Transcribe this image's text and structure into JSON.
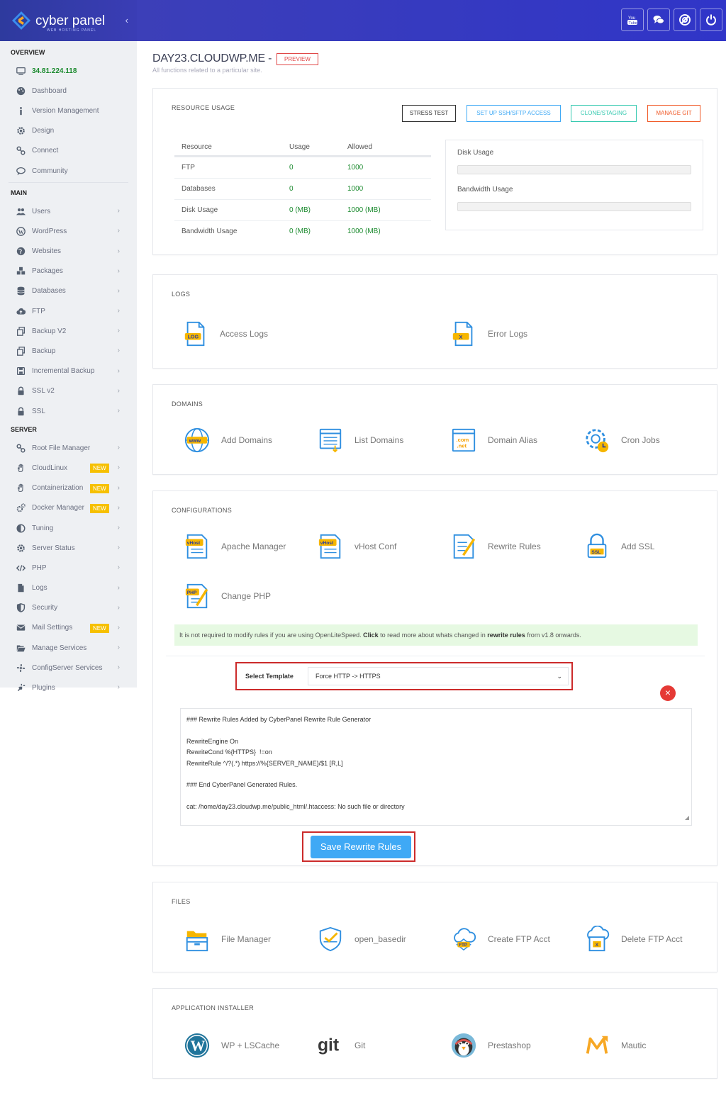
{
  "brand": {
    "name": "cyber panel",
    "tagline": "WEB HOSTING PANEL"
  },
  "sidebar": {
    "overview_label": "OVERVIEW",
    "ip": "34.81.224.118",
    "overview_items": [
      {
        "label": "Dashboard",
        "icon": "palette-icon"
      },
      {
        "label": "Version Management",
        "icon": "info-icon"
      },
      {
        "label": "Design",
        "icon": "gear-icon"
      },
      {
        "label": "Connect",
        "icon": "link-icon"
      },
      {
        "label": "Community",
        "icon": "chat-icon"
      }
    ],
    "main_label": "MAIN",
    "main_items": [
      {
        "label": "Users",
        "icon": "users-icon"
      },
      {
        "label": "WordPress",
        "icon": "wordpress-icon"
      },
      {
        "label": "Websites",
        "icon": "globe-icon"
      },
      {
        "label": "Packages",
        "icon": "cubes-icon"
      },
      {
        "label": "Databases",
        "icon": "database-icon"
      },
      {
        "label": "FTP",
        "icon": "cloud-upload-icon"
      },
      {
        "label": "Backup V2",
        "icon": "copy-icon"
      },
      {
        "label": "Backup",
        "icon": "copy-icon"
      },
      {
        "label": "Incremental Backup",
        "icon": "save-icon"
      },
      {
        "label": "SSL v2",
        "icon": "lock-icon"
      },
      {
        "label": "SSL",
        "icon": "lock-icon"
      }
    ],
    "server_label": "SERVER",
    "server_items": [
      {
        "label": "Root File Manager",
        "icon": "link-icon",
        "badge": ""
      },
      {
        "label": "CloudLinux",
        "icon": "hand-icon",
        "badge": "NEW"
      },
      {
        "label": "Containerization",
        "icon": "hand-icon",
        "badge": "NEW"
      },
      {
        "label": "Docker Manager",
        "icon": "cogs-icon",
        "badge": "NEW"
      },
      {
        "label": "Tuning",
        "icon": "half-circle-icon",
        "badge": ""
      },
      {
        "label": "Server Status",
        "icon": "gear-icon",
        "badge": ""
      },
      {
        "label": "PHP",
        "icon": "code-icon",
        "badge": ""
      },
      {
        "label": "Logs",
        "icon": "file-icon",
        "badge": ""
      },
      {
        "label": "Security",
        "icon": "shield-icon",
        "badge": ""
      },
      {
        "label": "Mail Settings",
        "icon": "envelope-icon",
        "badge": "NEW"
      },
      {
        "label": "Manage Services",
        "icon": "folder-open-icon",
        "badge": ""
      },
      {
        "label": "ConfigServer Services",
        "icon": "fan-icon",
        "badge": ""
      },
      {
        "label": "Plugins",
        "icon": "plug-icon",
        "badge": ""
      }
    ]
  },
  "topbar": {
    "icons": [
      "youtube-icon",
      "chat-icon",
      "support-icon",
      "power-icon"
    ]
  },
  "page": {
    "title": "DAY23.CLOUDWP.ME -",
    "preview": "PREVIEW",
    "subtitle": "All functions related to a particular site."
  },
  "resource": {
    "title": "RESOURCE USAGE",
    "buttons": {
      "stress": "STRESS TEST",
      "ssh": "SET UP SSH/SFTP ACCESS",
      "clone": "CLONE/STAGING",
      "git": "MANAGE GIT"
    },
    "headers": [
      "Resource",
      "Usage",
      "Allowed"
    ],
    "rows": [
      {
        "resource": "FTP",
        "usage": "0",
        "allowed": "1000"
      },
      {
        "resource": "Databases",
        "usage": "0",
        "allowed": "1000"
      },
      {
        "resource": "Disk Usage",
        "usage": "0 (MB)",
        "allowed": "1000 (MB)"
      },
      {
        "resource": "Bandwidth Usage",
        "usage": "0 (MB)",
        "allowed": "1000 (MB)"
      }
    ],
    "disk_label": "Disk Usage",
    "disk_fraction": 0,
    "bandwidth_label": "Bandwidth Usage",
    "bandwidth_fraction": 0
  },
  "logs": {
    "title": "LOGS",
    "items": [
      {
        "label": "Access Logs",
        "icon": "access-log-icon"
      },
      {
        "label": "Error Logs",
        "icon": "error-log-icon"
      }
    ]
  },
  "domains": {
    "title": "DOMAINS",
    "items": [
      {
        "label": "Add Domains",
        "icon": "www-globe-icon"
      },
      {
        "label": "List Domains",
        "icon": "list-domains-icon"
      },
      {
        "label": "Domain Alias",
        "icon": "domain-alias-icon"
      },
      {
        "label": "Cron Jobs",
        "icon": "cron-gear-icon"
      }
    ]
  },
  "configurations": {
    "title": "CONFIGURATIONS",
    "items": [
      {
        "label": "Apache Manager",
        "icon": "vhost-icon"
      },
      {
        "label": "vHost Conf",
        "icon": "vhost-icon"
      },
      {
        "label": "Rewrite Rules",
        "icon": "rewrite-rules-icon"
      },
      {
        "label": "Add SSL",
        "icon": "ssl-lock-icon"
      },
      {
        "label": "Change PHP",
        "icon": "php-file-icon"
      }
    ],
    "notice": {
      "part1": "It is not required to modify rules if you are using OpenLiteSpeed. ",
      "click": "Click",
      "part2": " to read more about whats changed in ",
      "rewrite": "rewrite rules",
      "part3": " from v1.8 onwards."
    },
    "template_label": "Select Template",
    "template_value": "Force HTTP -> HTTPS",
    "rules_text": "### Rewrite Rules Added by CyberPanel Rewrite Rule Generator\n\nRewriteEngine On\nRewriteCond %{HTTPS}  !=on\nRewriteRule ^/?(.*) https://%{SERVER_NAME}/$1 [R,L]\n\n### End CyberPanel Generated Rules.\n\ncat: /home/day23.cloudwp.me/public_html/.htaccess: No such file or directory",
    "save_label": "Save Rewrite Rules"
  },
  "files": {
    "title": "FILES",
    "items": [
      {
        "label": "File Manager",
        "icon": "file-manager-icon"
      },
      {
        "label": "open_basedir",
        "icon": "shield-check-icon"
      },
      {
        "label": "Create FTP Acct",
        "icon": "ftp-cloud-icon"
      },
      {
        "label": "Delete FTP Acct",
        "icon": "ftp-delete-icon"
      }
    ]
  },
  "apps": {
    "title": "APPLICATION INSTALLER",
    "items": [
      {
        "label": "WP + LSCache",
        "icon": "wordpress-logo-icon"
      },
      {
        "label": "Git",
        "icon": "git-logo-icon"
      },
      {
        "label": "Prestashop",
        "icon": "prestashop-logo-icon"
      },
      {
        "label": "Mautic",
        "icon": "mautic-logo-icon"
      }
    ]
  },
  "colors": {
    "accent_blue": "#3fa9f5",
    "highlight_red": "#cc2b2b",
    "value_green": "#1b8a2e",
    "badge_yellow": "#f6c000"
  }
}
